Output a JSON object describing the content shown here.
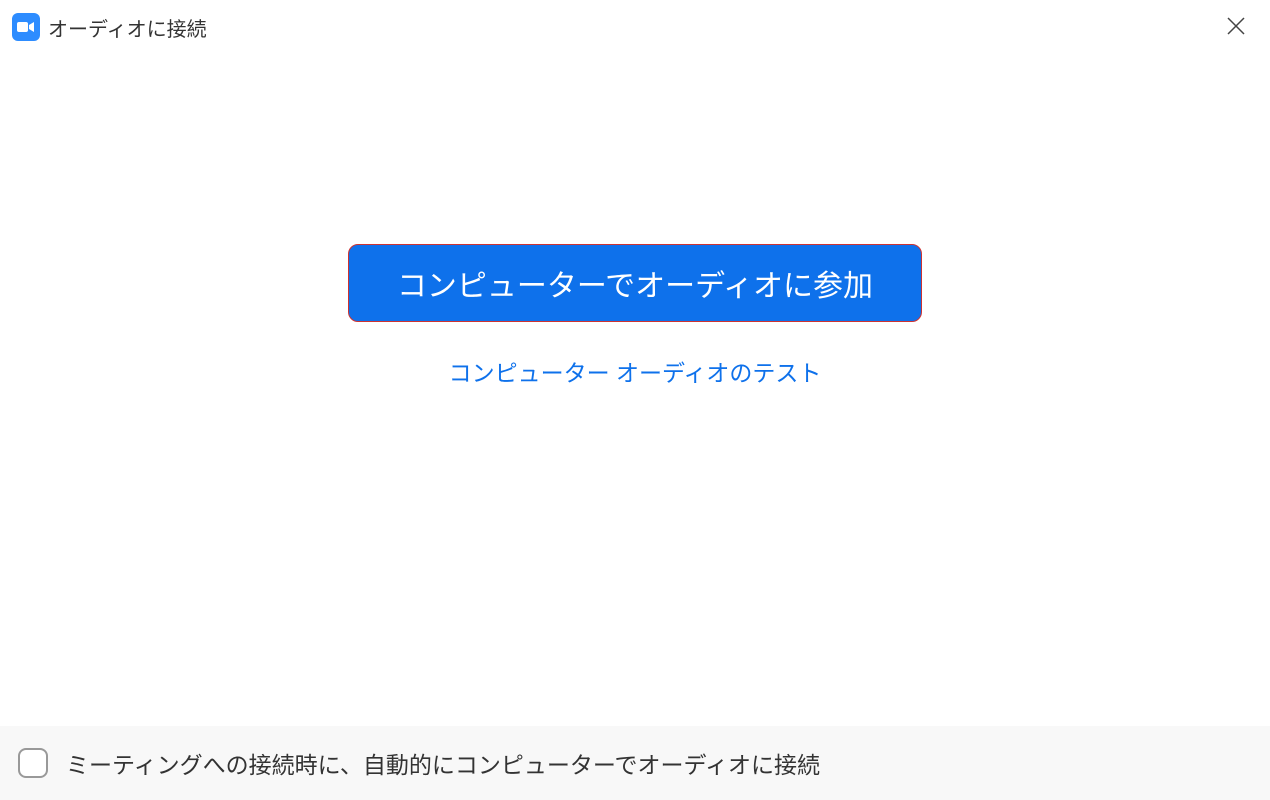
{
  "header": {
    "title": "オーディオに接続"
  },
  "main": {
    "join_button_label": "コンピューターでオーディオに参加",
    "test_link_label": "コンピューター オーディオのテスト"
  },
  "footer": {
    "checkbox_label": "ミーティングへの接続時に、自動的にコンピューターでオーディオに接続"
  },
  "colors": {
    "primary_blue": "#0E71EB",
    "highlight_border": "#cc3333"
  }
}
